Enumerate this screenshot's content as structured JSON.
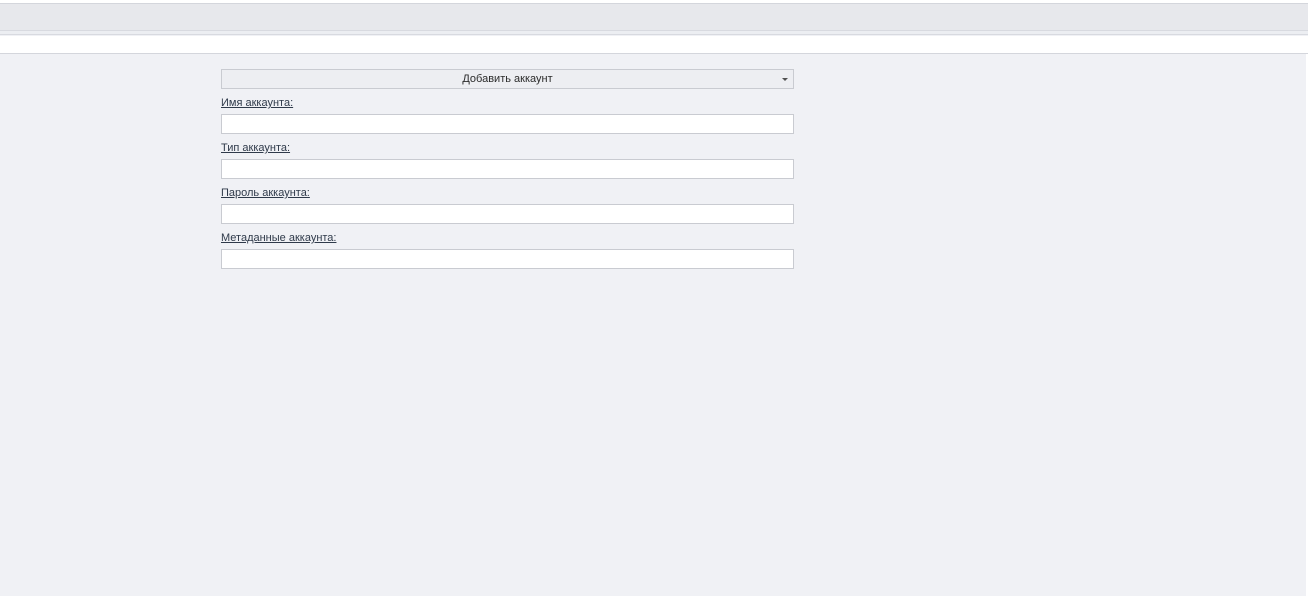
{
  "form": {
    "dropdown_label": "Добавить аккаунт",
    "fields": [
      {
        "label": "Имя аккаунта:",
        "value": ""
      },
      {
        "label": "Тип аккаунта:",
        "value": ""
      },
      {
        "label": "Пароль аккаунта:",
        "value": ""
      },
      {
        "label": "Метаданные аккаунта:",
        "value": ""
      }
    ]
  },
  "icons": {
    "dropdown_caret": "chevron-down-icon"
  }
}
